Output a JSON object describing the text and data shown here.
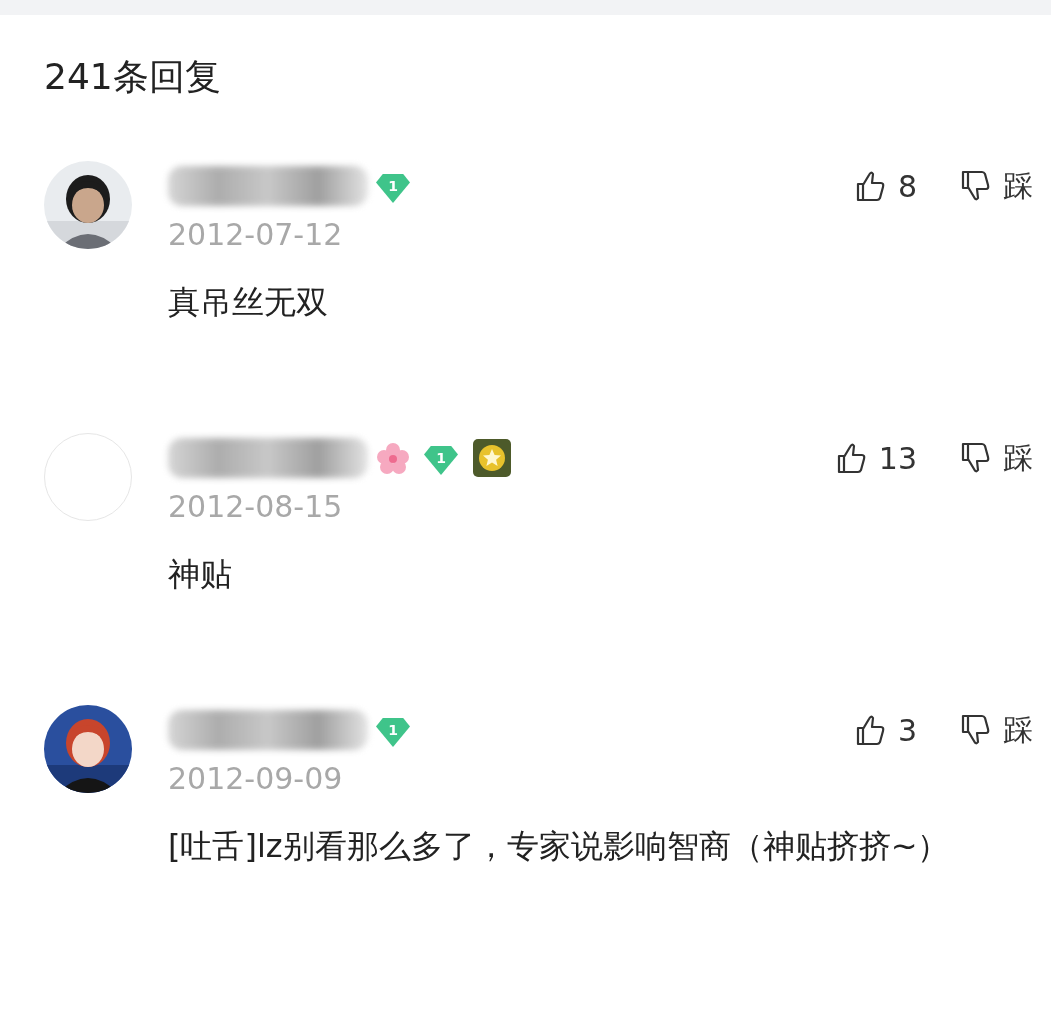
{
  "header": {
    "title": "241条回复"
  },
  "comments": [
    {
      "badges": [
        {
          "kind": "level",
          "text": "1"
        }
      ],
      "date": "2012-07-12",
      "text": "真吊丝无双",
      "likes": "8",
      "dislike": "踩"
    },
    {
      "avatar": {
        "kind": "empty"
      },
      "badges": [
        {
          "kind": "flower"
        },
        {
          "kind": "level",
          "text": "1"
        },
        {
          "kind": "medal"
        }
      ],
      "date": "2012-08-15",
      "text": "神贴",
      "likes": "13",
      "dislike": "踩"
    },
    {
      "avatar": {
        "kind": "illustration"
      },
      "badges": [
        {
          "kind": "level",
          "text": "1"
        }
      ],
      "date": "2012-09-09",
      "text": "[吐舌]lz别看那么多了，专家说影响智商（神贴挤挤~）",
      "likes": "3",
      "dislike": "踩"
    }
  ]
}
